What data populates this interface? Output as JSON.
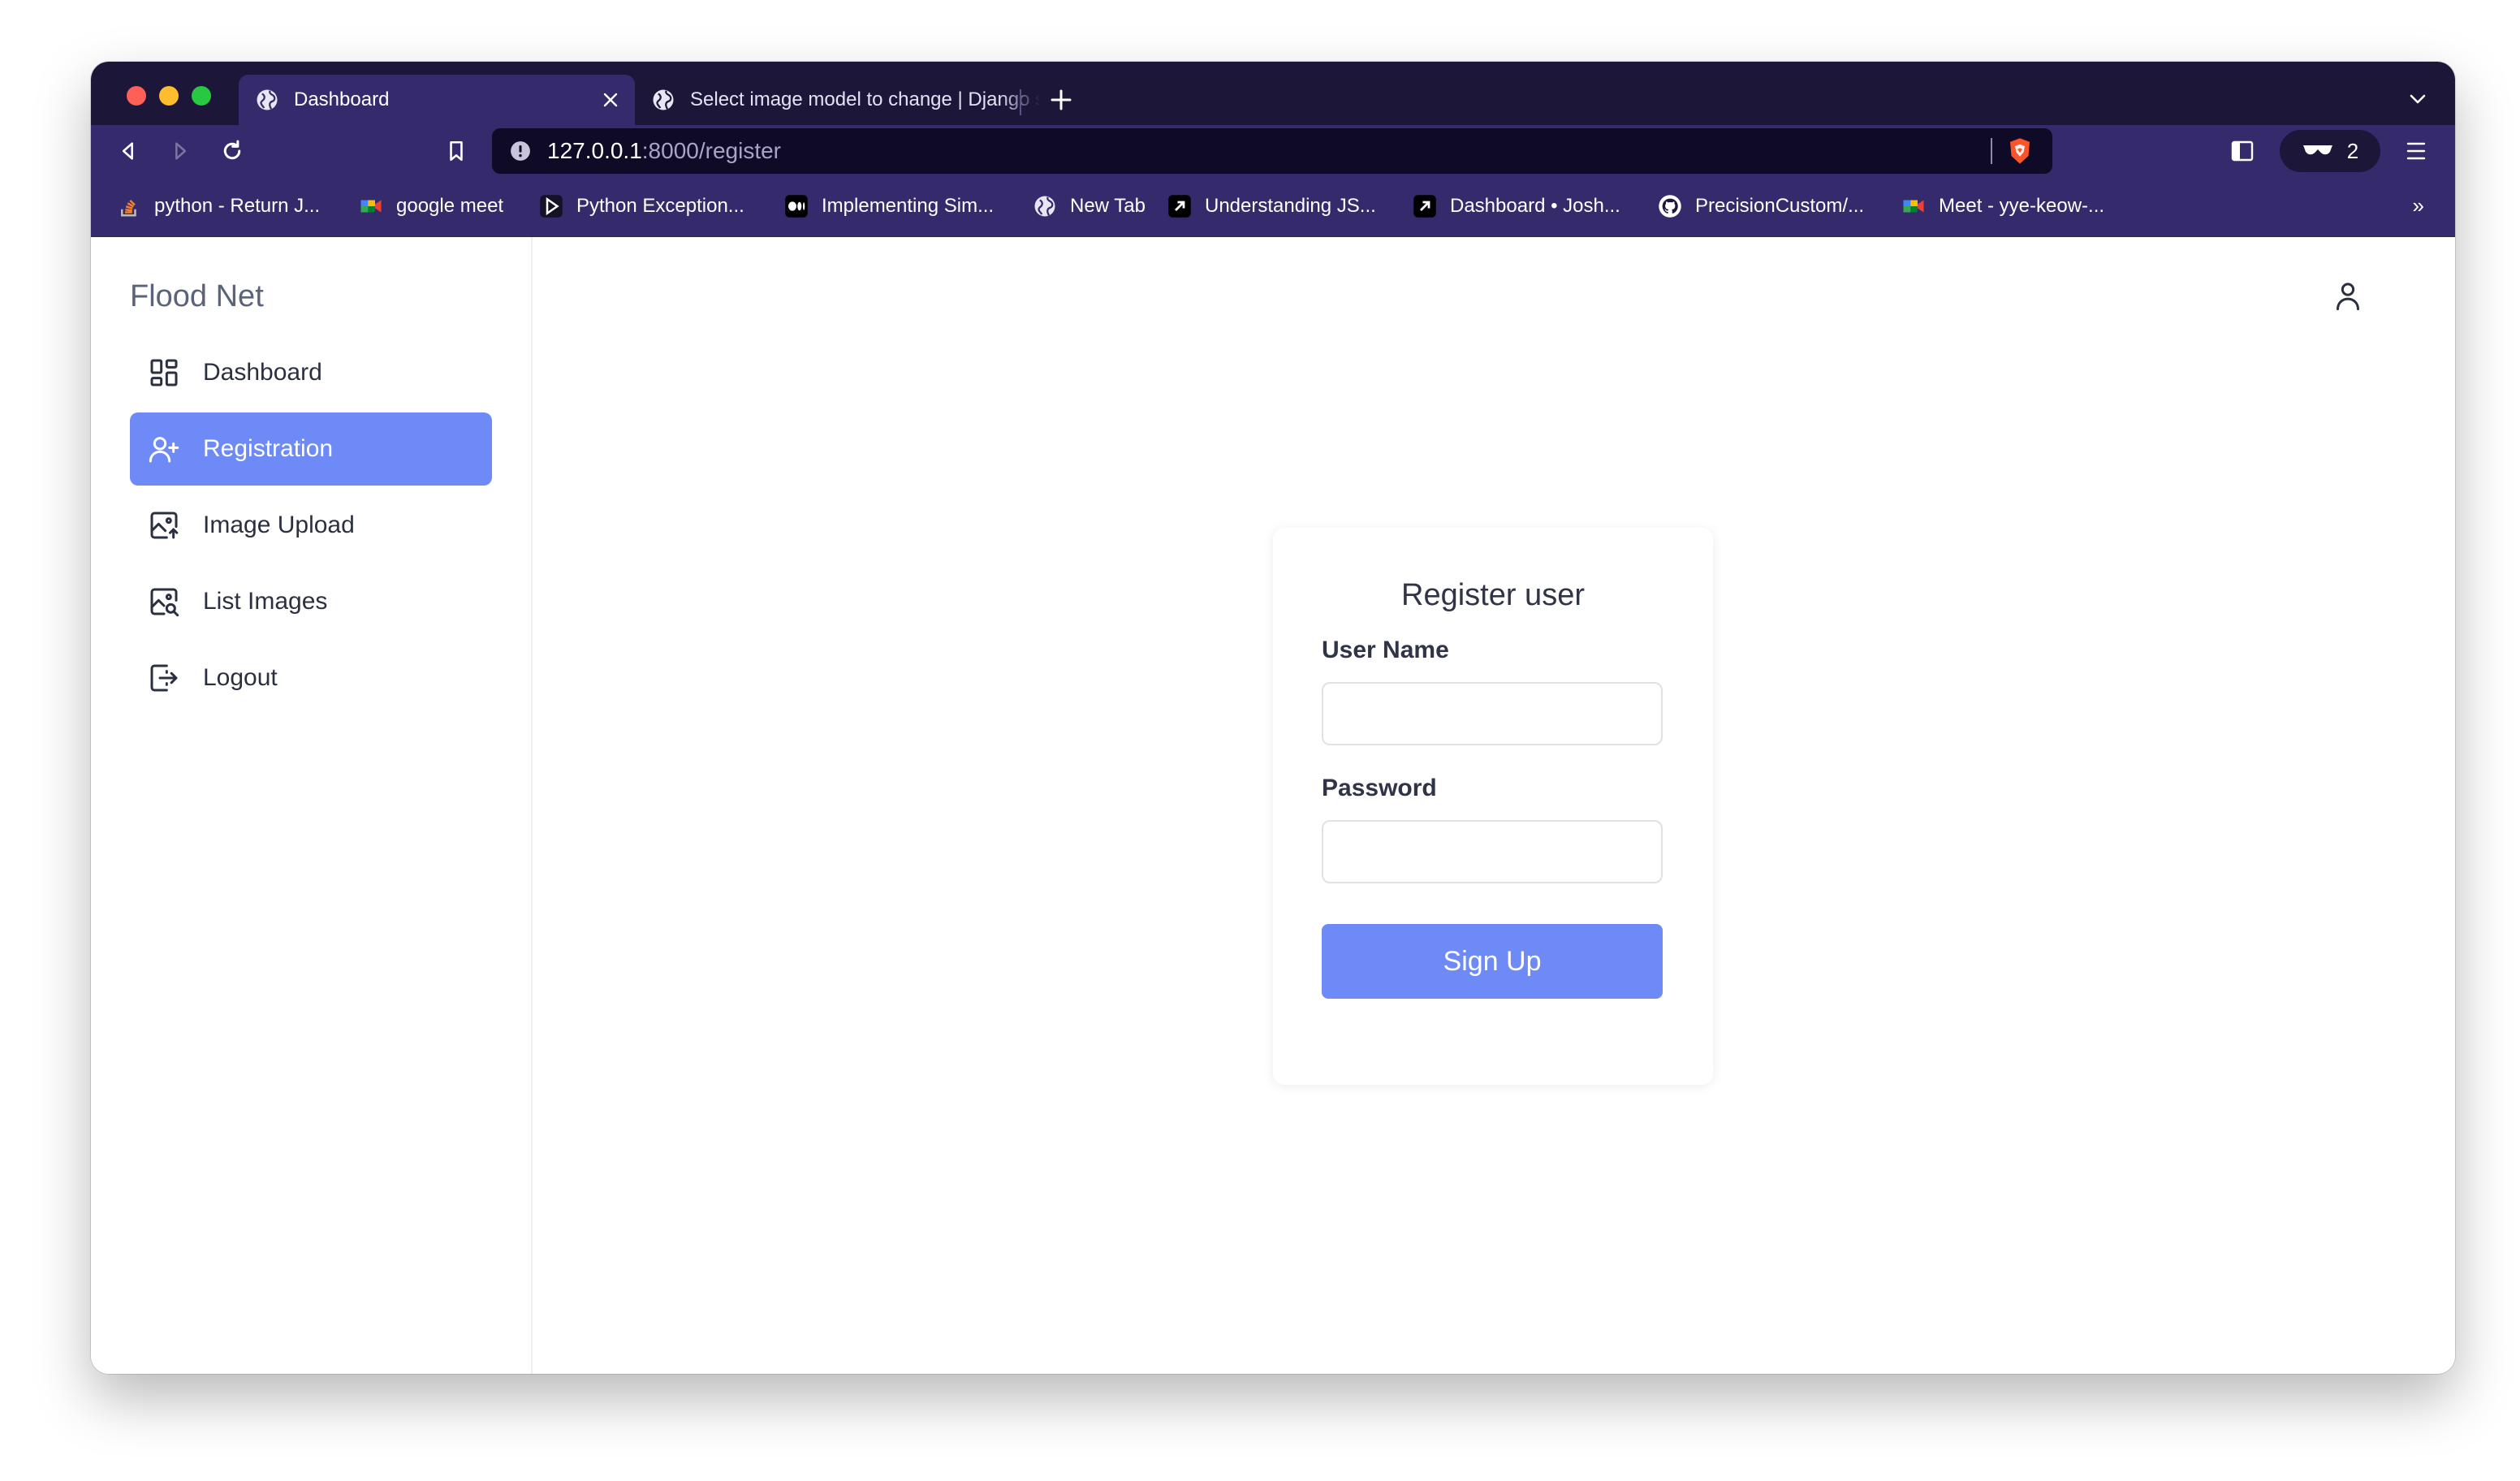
{
  "browser": {
    "tabs": [
      {
        "title": "Dashboard",
        "active": true
      },
      {
        "title": "Select image model to change | Django site admin",
        "active": false
      }
    ],
    "url": {
      "host": "127.0.0.1",
      "path": ":8000/register"
    },
    "shields_count": "2",
    "bookmarks": [
      {
        "label": "python - Return J...",
        "icon": "stackoverflow-icon"
      },
      {
        "label": "google meet",
        "icon": "google-meet-icon"
      },
      {
        "label": "Python Exception...",
        "icon": "play-icon"
      },
      {
        "label": "Implementing Sim...",
        "icon": "medium-icon"
      },
      {
        "label": "New Tab",
        "icon": "globe-icon"
      },
      {
        "label": "Understanding JS...",
        "icon": "arrow-link-icon"
      },
      {
        "label": "Dashboard • Josh...",
        "icon": "arrow-link-icon"
      },
      {
        "label": "PrecisionCustom/...",
        "icon": "github-icon"
      },
      {
        "label": "Meet - yye-keow-...",
        "icon": "google-meet-icon"
      }
    ],
    "bookmarks_more": "»"
  },
  "app": {
    "brand": "Flood Net",
    "nav": [
      {
        "label": "Dashboard",
        "icon": "dashboard-icon",
        "active": false
      },
      {
        "label": "Registration",
        "icon": "user-plus-icon",
        "active": true
      },
      {
        "label": "Image Upload",
        "icon": "image-upload-icon",
        "active": false
      },
      {
        "label": "List Images",
        "icon": "image-search-icon",
        "active": false
      },
      {
        "label": "Logout",
        "icon": "logout-icon",
        "active": false
      }
    ]
  },
  "form": {
    "title": "Register user",
    "username_label": "User Name",
    "username_value": "",
    "password_label": "Password",
    "password_value": "",
    "submit_label": "Sign Up"
  },
  "colors": {
    "accent": "#6e8af7",
    "browser_dark": "#1c1638",
    "browser_toolbar": "#352a6b"
  }
}
